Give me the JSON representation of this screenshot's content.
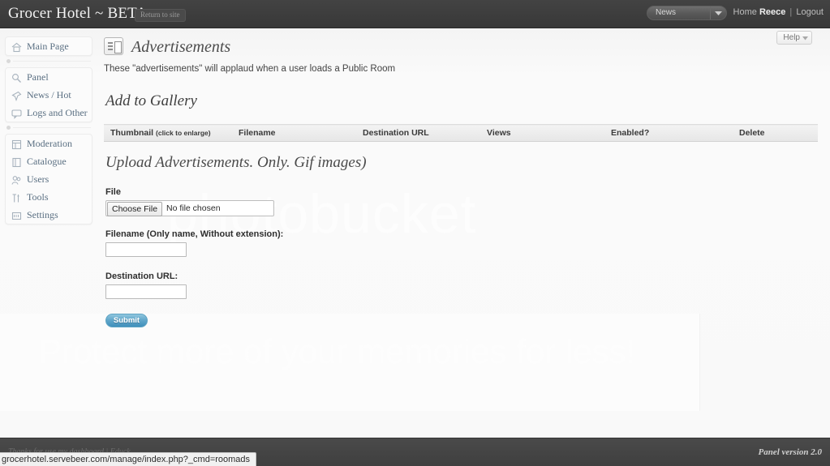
{
  "topbar": {
    "brand": "Grocer Hotel ~ BETA",
    "return_to_site": "Return to site",
    "news_dropdown": "News",
    "home_label": "Home",
    "user": "Reece",
    "separator": "|",
    "logout_label": "Logout"
  },
  "sidebar": {
    "groups": [
      {
        "items": [
          {
            "label": "Main Page",
            "icon": "home-icon"
          }
        ]
      },
      {
        "items": [
          {
            "label": "Panel",
            "icon": "panel-icon"
          },
          {
            "label": "News / Hot",
            "icon": "pin-icon"
          },
          {
            "label": "Logs and Other",
            "icon": "chat-icon"
          }
        ]
      },
      {
        "items": [
          {
            "label": "Moderation",
            "icon": "moderation-icon"
          },
          {
            "label": "Catalogue",
            "icon": "book-icon"
          },
          {
            "label": "Users",
            "icon": "users-icon"
          },
          {
            "label": "Tools",
            "icon": "tools-icon"
          },
          {
            "label": "Settings",
            "icon": "settings-icon"
          }
        ]
      }
    ]
  },
  "content": {
    "help_label": "Help",
    "page_title": "Advertisements",
    "page_description": "These \"advertisements\" will applaud when a user loads a Public Room",
    "gallery_title": "Add to Gallery",
    "upload_title": "Upload Advertisements. Only. Gif images)",
    "table": {
      "columns": [
        {
          "label": "Thumbnail",
          "sub": "(click to enlarge)"
        },
        {
          "label": "Filename",
          "sub": ""
        },
        {
          "label": "Destination URL",
          "sub": ""
        },
        {
          "label": "Views",
          "sub": ""
        },
        {
          "label": "Enabled?",
          "sub": ""
        },
        {
          "label": "Delete",
          "sub": ""
        }
      ],
      "rows": []
    },
    "form": {
      "file_label": "File",
      "file_button": "Choose File",
      "file_status": "No file chosen",
      "filename_label": "Filename (Only name, Without extension):",
      "filename_value": "",
      "filename_placeholder": "",
      "destination_label": "Destination URL:",
      "destination_value": "",
      "destination_placeholder": "",
      "submit_label": "Submit"
    }
  },
  "watermark": {
    "brand": "photobucket",
    "tagline": "Protect more of your memories for less!"
  },
  "footer": {
    "credit": "Thanks for use my dashboard | Educk",
    "version": "Panel version 2.0"
  },
  "statusbar": {
    "url": "grocerhotel.servebeer.com/manage/index.php?_cmd=roomads"
  }
}
